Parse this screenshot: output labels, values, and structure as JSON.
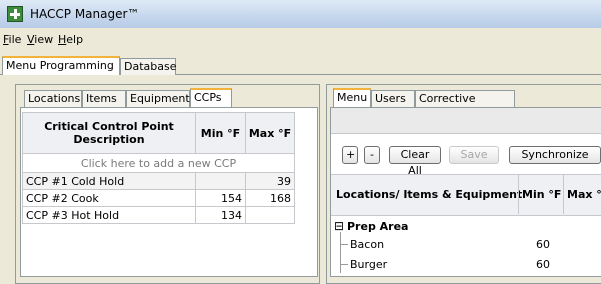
{
  "window": {
    "title": "HACCP Manager™"
  },
  "menubar": {
    "items": [
      "File",
      "View",
      "Help"
    ],
    "underline": [
      "F",
      "V",
      "H"
    ],
    "rest": [
      "ile",
      "iew",
      "elp"
    ]
  },
  "top_tabs": [
    "Menu Programming",
    "Database"
  ],
  "left": {
    "tabs": [
      "Locations",
      "Items",
      "Equipment",
      "CCPs"
    ],
    "grid": {
      "columns": [
        "Critical Control Point Description",
        "Min °F",
        "Max °F"
      ],
      "add_row": "Click here to add a new CCP",
      "rows": [
        {
          "desc": "CCP #1 Cold Hold",
          "min": "",
          "max": "39"
        },
        {
          "desc": "CCP #2 Cook",
          "min": "154",
          "max": "168"
        },
        {
          "desc": "CCP #3 Hot Hold",
          "min": "134",
          "max": ""
        }
      ]
    }
  },
  "right": {
    "tabs": [
      "Menu",
      "Users",
      "Corrective Actions"
    ],
    "toolbar": {
      "plus": "+",
      "minus": "-",
      "clear_all": "Clear All",
      "save": "Save",
      "synchronize": "Synchronize"
    },
    "grid": {
      "columns": [
        "Locations/ Items & Equipment",
        "Min °F",
        "Max °"
      ],
      "group": {
        "expander": "⊟",
        "name": "Prep Area"
      },
      "rows": [
        {
          "name": "Bacon",
          "min": "60"
        },
        {
          "name": "Burger",
          "min": "60"
        }
      ]
    }
  },
  "colors": {
    "active_tab_accent": "#f1b33a",
    "titlebar": "#c7d8ee"
  }
}
